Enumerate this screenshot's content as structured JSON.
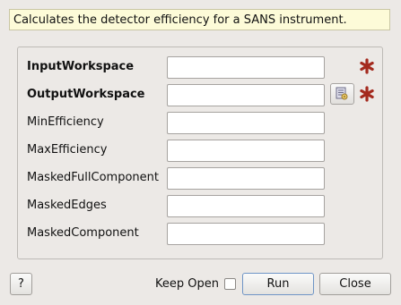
{
  "description": "Calculates the detector efficiency for a SANS instrument.",
  "properties": [
    {
      "label": "InputWorkspace",
      "value": "",
      "required": true
    },
    {
      "label": "OutputWorkspace",
      "value": "",
      "required": true
    },
    {
      "label": "MinEfficiency",
      "value": "",
      "required": false
    },
    {
      "label": "MaxEfficiency",
      "value": "",
      "required": false
    },
    {
      "label": "MaskedFullComponent",
      "value": "",
      "required": false
    },
    {
      "label": "MaskedEdges",
      "value": "",
      "required": false
    },
    {
      "label": "MaskedComponent",
      "value": "",
      "required": false
    }
  ],
  "icons": {
    "required": "asterisk-icon",
    "browse": "workspace-browse-icon"
  },
  "colors": {
    "required_star": "#a42a1e",
    "description_bg": "#fdfbd8",
    "default_button_border": "#6f95c6"
  },
  "footer": {
    "help_label": "?",
    "keep_open_label": "Keep Open",
    "keep_open_checked": false,
    "run_label": "Run",
    "close_label": "Close"
  }
}
